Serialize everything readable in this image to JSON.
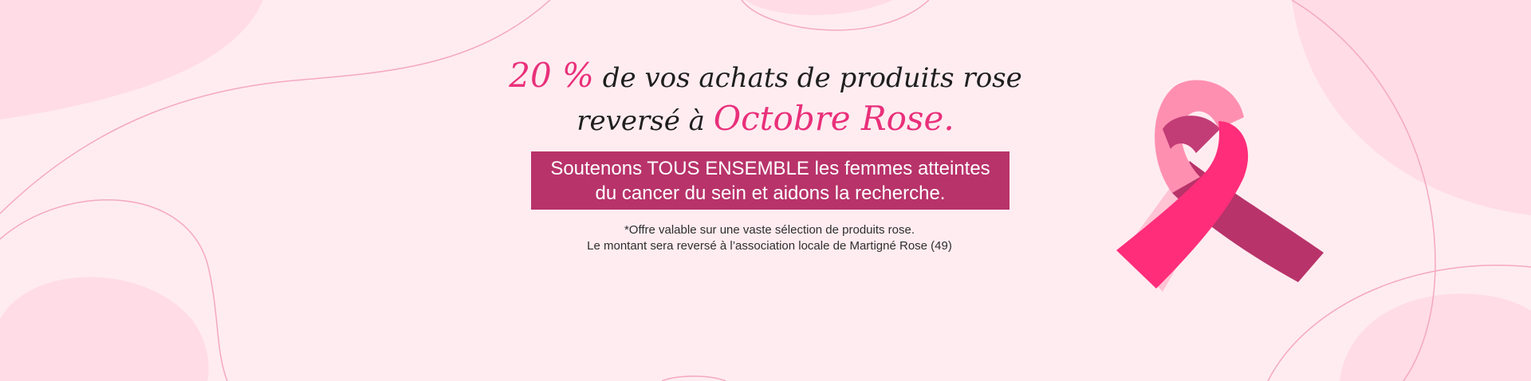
{
  "headline": {
    "highlight_prefix": "20 %",
    "line1_rest": " de vos achats de produits rose",
    "line2_prefix": "reversé à ",
    "highlight_name": "Octobre Rose",
    "line2_suffix": "."
  },
  "banner": {
    "line1": "Soutenons TOUS ENSEMBLE les femmes atteintes",
    "line2": "du cancer du sein et aidons la recherche."
  },
  "note": {
    "line1": "*Offre valable sur une vaste sélection de produits rose.",
    "line2": "Le montant sera reversé à l’association locale de Martigné Rose (49)"
  },
  "colors": {
    "background": "#ffecf1",
    "accent_pink": "#e9307a",
    "banner": "#b8336a",
    "ribbon_light": "#ff8fb0",
    "ribbon_bright": "#ff2d7a",
    "ribbon_dark": "#b8336a"
  },
  "icons": {
    "ribbon": "pink-awareness-ribbon-icon"
  }
}
